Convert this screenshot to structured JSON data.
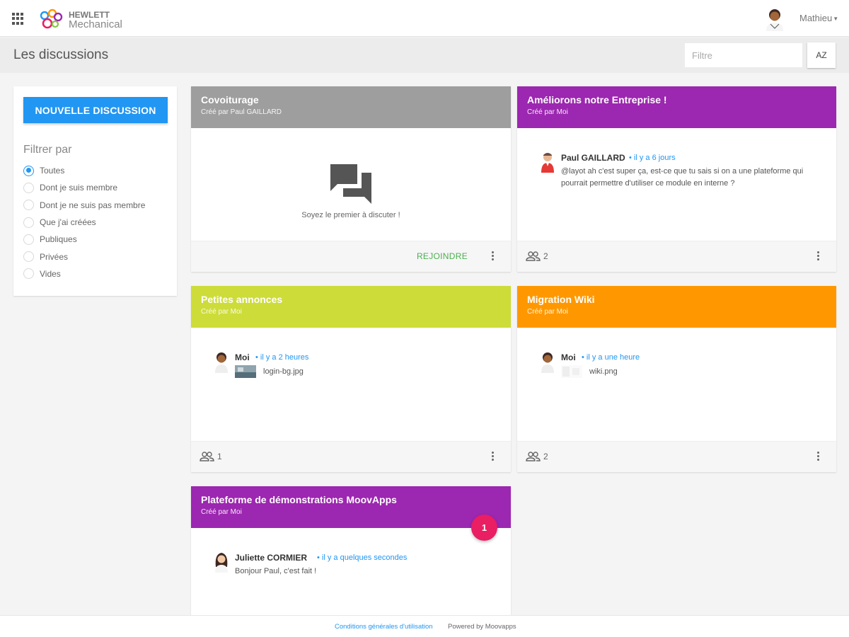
{
  "colors": {
    "primary": "#2196f3",
    "grey_header": "#9e9e9e",
    "purple_header": "#9c27b0",
    "lime_header": "#cddc39",
    "orange_header": "#ff9800",
    "join_green": "#4caf50",
    "badge_pink": "#e91e63"
  },
  "topbar": {
    "logo_line1": "HEWLETT",
    "logo_line2": "Mechanical",
    "user_name": "Mathieu"
  },
  "header": {
    "title": "Les discussions",
    "filter_placeholder": "Filtre",
    "sort_label": "AZ"
  },
  "sidebar": {
    "new_button": "NOUVELLE DISCUSSION",
    "filter_title": "Filtrer par",
    "filters": [
      {
        "label": "Toutes",
        "selected": true
      },
      {
        "label": "Dont je suis membre",
        "selected": false
      },
      {
        "label": "Dont je ne suis pas membre",
        "selected": false
      },
      {
        "label": "Que j'ai créées",
        "selected": false
      },
      {
        "label": "Publiques",
        "selected": false
      },
      {
        "label": "Privées",
        "selected": false
      },
      {
        "label": "Vides",
        "selected": false
      }
    ]
  },
  "cards": [
    {
      "title": "Covoiturage",
      "subtitle": "Créé par Paul GAILLARD",
      "empty_text": "Soyez le premier à discuter !",
      "join_label": "REJOINDRE"
    },
    {
      "title": "Améliorons notre Entreprise !",
      "subtitle": "Créé par Moi",
      "author": "Paul GAILLARD",
      "time": "il y a 6 jours",
      "text": "@layot ah c'est super ça, est-ce que tu sais si on a une plateforme qui pourrait permettre d'utiliser ce module en interne ?",
      "members": "2"
    },
    {
      "title": "Petites annonces",
      "subtitle": "Créé par Moi",
      "author": "Moi",
      "time": "il y a 2 heures",
      "attachment": "login-bg.jpg",
      "members": "1"
    },
    {
      "title": "Migration Wiki",
      "subtitle": "Créé par Moi",
      "author": "Moi",
      "time": "il y a une heure",
      "attachment": "wiki.png",
      "members": "2"
    },
    {
      "title": "Plateforme de démonstrations MoovApps",
      "subtitle": "Créé par Moi",
      "author": "Juliette CORMIER",
      "time": "il y a quelques secondes",
      "text": "Bonjour Paul, c'est fait !",
      "badge": "1"
    }
  ],
  "footer": {
    "terms": "Conditions générales d'utilisation",
    "powered": "Powered by Moovapps"
  }
}
